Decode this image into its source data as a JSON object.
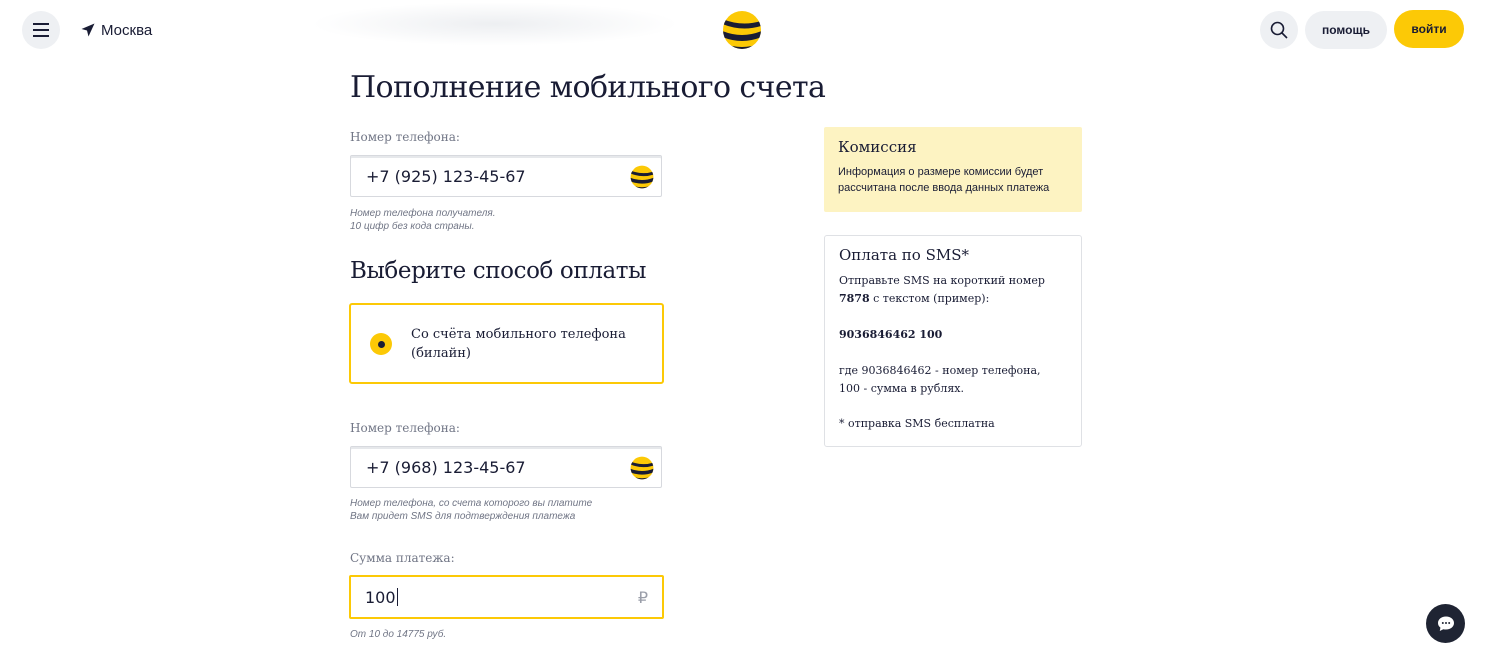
{
  "header": {
    "city": "Москва",
    "help_label": "помощь",
    "login_label": "войти"
  },
  "colors": {
    "brand_yellow": "#fcc906",
    "ink": "#191c34",
    "commission_bg": "#fdf3c2"
  },
  "icons": [
    "menu-icon",
    "location-arrow-icon",
    "beeline-logo",
    "search-icon",
    "chat-icon",
    "ruble-icon"
  ],
  "main": {
    "title": "Пополнение мобильного счета",
    "recipient": {
      "label": "Номер телефона:",
      "value": "+7 (925) 123-45-67",
      "hint_line1": "Номер телефона получателя.",
      "hint_line2": "10 цифр без кода страны."
    },
    "payment_method": {
      "title": "Выберите способ оплаты",
      "option_label": "Со счёта мобильного телефона (билайн)",
      "selected": true
    },
    "payer": {
      "label": "Номер телефона:",
      "value": "+7 (968) 123-45-67",
      "hint_line1": "Номер телефона, со счета которого вы платите",
      "hint_line2": "Вам придет SMS для подтверждения платежа"
    },
    "amount": {
      "label": "Сумма платежа:",
      "value": "100",
      "currency": "₽",
      "hint": "От 10 до 14775 руб."
    }
  },
  "commission": {
    "title": "Комиссия",
    "text": "Информация о размере комиссии будет рассчитана после ввода данных платежа"
  },
  "sms_payment": {
    "title": "Оплата по SMS*",
    "intro_prefix": "Отправьте SMS на короткий номер",
    "short_number": "7878",
    "intro_suffix": "с текстом (пример):",
    "example": "9036846462 100",
    "explain_line1": "где 9036846462 - номер телефона,",
    "explain_line2": "100 - сумма в рублях.",
    "footnote": "* отправка SMS бесплатна"
  }
}
